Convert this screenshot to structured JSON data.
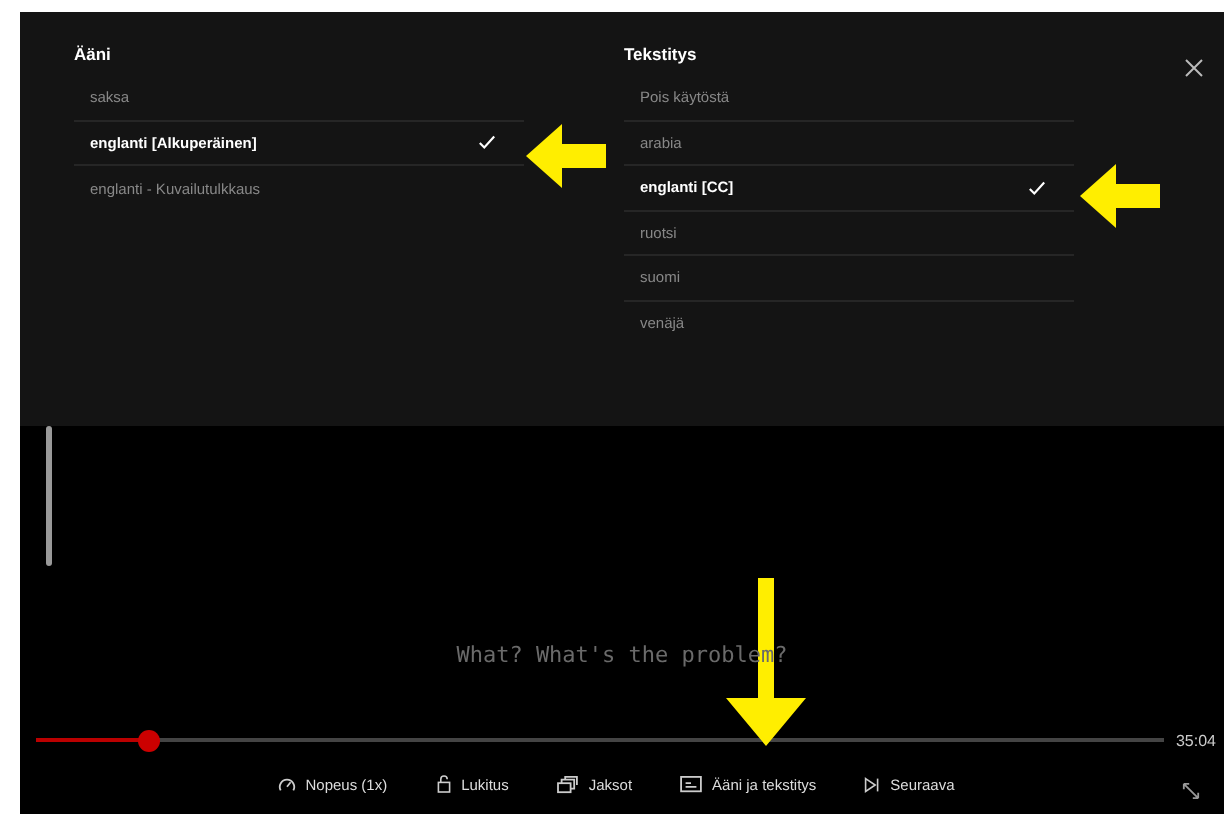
{
  "audio": {
    "title": "Ääni",
    "items": [
      {
        "label": "saksa",
        "selected": false
      },
      {
        "label": "englanti [Alkuperäinen]",
        "selected": true
      },
      {
        "label": "englanti - Kuvailutulkkaus",
        "selected": false
      }
    ]
  },
  "subtitles": {
    "title": "Tekstitys",
    "items": [
      {
        "label": "Pois käytöstä",
        "selected": false
      },
      {
        "label": "arabia",
        "selected": false
      },
      {
        "label": "englanti [CC]",
        "selected": true
      },
      {
        "label": "ruotsi",
        "selected": false
      },
      {
        "label": "suomi",
        "selected": false
      },
      {
        "label": "venäjä",
        "selected": false
      }
    ]
  },
  "caption": "What? What's the problem?",
  "progress": {
    "level": 0.1,
    "remaining": "35:04"
  },
  "controls": [
    {
      "kind": "speed",
      "label": "Nopeus (1x)"
    },
    {
      "kind": "lock",
      "label": "Lukitus"
    },
    {
      "kind": "episodes",
      "label": "Jaksot"
    },
    {
      "kind": "audio-subtitles",
      "label": "Ääni ja tekstitys"
    },
    {
      "kind": "next",
      "label": "Seuraava"
    }
  ]
}
